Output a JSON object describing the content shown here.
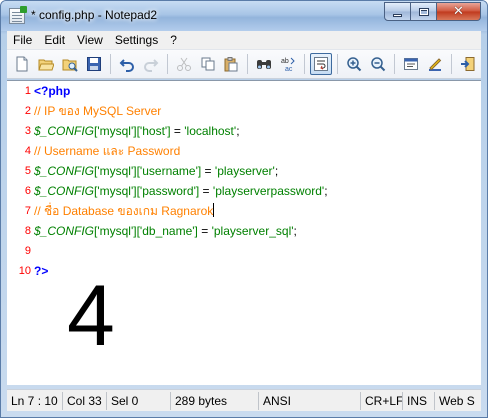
{
  "window": {
    "title": "* config.php - Notepad2"
  },
  "menu": [
    "File",
    "Edit",
    "View",
    "Settings",
    "?"
  ],
  "toolbar": {
    "icons": [
      "new-file-icon",
      "open-folder-icon",
      "browse-icon",
      "save-icon",
      "undo-icon",
      "redo-icon",
      "cut-icon",
      "copy-icon",
      "paste-icon",
      "find-icon",
      "replace-icon",
      "word-wrap-icon",
      "zoom-in-icon",
      "zoom-out-icon",
      "scheme-icon",
      "customize-scheme-icon",
      "exit-icon"
    ]
  },
  "editor": {
    "lines": [
      {
        "num": "1",
        "segments": [
          {
            "cls": "php-tag",
            "text": "<?php"
          }
        ]
      },
      {
        "num": "2",
        "segments": [
          {
            "cls": "comment",
            "text": "// IP ของ MySQL Server"
          }
        ]
      },
      {
        "num": "3",
        "segments": [
          {
            "cls": "var",
            "text": "$_CONFIG"
          },
          {
            "cls": "str",
            "text": "['mysql']['host']"
          },
          {
            "cls": "op",
            "text": " = "
          },
          {
            "cls": "str",
            "text": "'localhost'"
          },
          {
            "cls": "op",
            "text": ";"
          }
        ]
      },
      {
        "num": "4",
        "segments": [
          {
            "cls": "comment",
            "text": "// Username และ Password"
          }
        ]
      },
      {
        "num": "5",
        "segments": [
          {
            "cls": "var",
            "text": "$_CONFIG"
          },
          {
            "cls": "str",
            "text": "['mysql']['username']"
          },
          {
            "cls": "op",
            "text": " = "
          },
          {
            "cls": "str",
            "text": "'playserver'"
          },
          {
            "cls": "op",
            "text": ";"
          }
        ]
      },
      {
        "num": "6",
        "segments": [
          {
            "cls": "var",
            "text": "$_CONFIG"
          },
          {
            "cls": "str",
            "text": "['mysql']['password']"
          },
          {
            "cls": "op",
            "text": " = "
          },
          {
            "cls": "str",
            "text": "'playserverpassword'"
          },
          {
            "cls": "op",
            "text": ";"
          }
        ]
      },
      {
        "num": "7",
        "segments": [
          {
            "cls": "comment",
            "text": "// ชื่อ Database ของเกม Ragnarok"
          }
        ],
        "caret": true
      },
      {
        "num": "8",
        "segments": [
          {
            "cls": "var",
            "text": "$_CONFIG"
          },
          {
            "cls": "str",
            "text": "['mysql']['db_name']"
          },
          {
            "cls": "op",
            "text": " = "
          },
          {
            "cls": "str",
            "text": "'playserver_sql'"
          },
          {
            "cls": "op",
            "text": ";"
          }
        ]
      },
      {
        "num": "9",
        "segments": []
      },
      {
        "num": "10",
        "segments": [
          {
            "cls": "php-tag",
            "text": "?>"
          }
        ]
      }
    ],
    "overlay_number": "4"
  },
  "status": {
    "position": "Ln 7 : 10",
    "column": "Col 33",
    "selection": "Sel 0",
    "size": "289 bytes",
    "encoding": "ANSI",
    "line_endings": "CR+LF",
    "insert_mode": "INS",
    "scheme": "Web S"
  },
  "colors": {
    "line_numbers": "#ff0000",
    "php_tag": "#0000ff",
    "comment": "#ff8000",
    "variable": "#008000",
    "string": "#008000"
  }
}
